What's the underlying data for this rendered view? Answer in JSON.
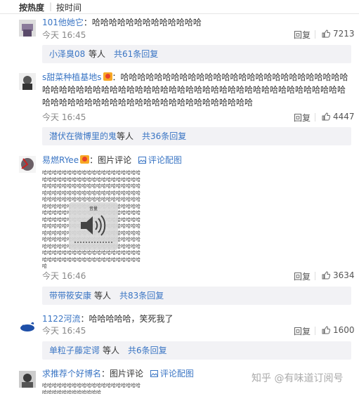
{
  "sort": {
    "hot": "按热度",
    "sep": "|",
    "time": "按时间"
  },
  "icons": {
    "like": "thumbs-up-icon",
    "image": "image-icon",
    "badge": "vip-badge-icon",
    "speaker": "speaker-icon"
  },
  "colors": {
    "link": "#3a75c4",
    "sub_bg": "#f2f2f5",
    "badge": "#f7a825"
  },
  "comments": [
    {
      "user": "101他她它",
      "text": "：哈哈哈哈哈哈哈哈哈哈哈哈哈",
      "time": "今天 16:45",
      "reply": "回复",
      "likes": "7213",
      "sub": {
        "who": "小泽臭08",
        "rest": " 等人 ",
        "count": "共61条回复"
      }
    },
    {
      "user": "s甜菜种植基地s",
      "text": "：哈哈哈哈哈哈哈哈哈哈哈哈哈哈哈哈哈哈哈哈哈哈哈哈哈哈哈哈哈哈哈哈哈哈哈哈哈哈哈哈哈哈哈哈哈哈哈哈哈哈哈哈哈哈哈哈哈哈哈哈哈哈哈哈哈哈哈哈哈哈哈哈哈哈哈哈哈哈哈哈哈哈哈哈哈哈哈哈",
      "time": "今天 16:45",
      "reply": "回复",
      "likes": "4447",
      "sub": {
        "who": "潜伏在微博里的鬼",
        "rest": " 等人 ",
        "count": "共36条回复"
      }
    },
    {
      "user": "易燃RYee",
      "text": "：图片评论",
      "piclink": "评论配图",
      "pic_text": "哈哈哈哈哈哈哈哈哈哈哈哈哈哈哈哈哈哈哈哈哈哈哈哈哈哈哈哈哈哈哈哈哈哈哈哈哈哈哈哈哈哈哈哈哈哈哈哈哈哈哈哈哈哈哈哈哈哈哈哈哈哈哈哈哈哈哈哈哈哈哈哈哈哈哈哈哈哈哈哈哈哈哈哈哈哈哈哈哈哈哈哈哈哈哈哈哈哈哈哈哈哈哈哈哈哈哈哈哈哈哈哈哈哈哈哈哈哈哈哈哈哈哈哈哈哈哈哈哈哈哈哈哈哈哈哈哈哈哈哈哈哈哈哈哈哈哈哈哈哈哈哈哈哈哈哈哈哈哈哈哈哈哈哈哈哈哈哈哈哈哈哈哈哈哈哈哈哈哈哈哈哈哈哈哈哈哈哈哈哈哈哈哈哈哈哈哈哈哈哈哈哈哈哈哈哈哈哈哈哈哈哈哈哈哈哈哈哈哈哈哈哈哈哈哈哈哈哈哈哈哈哈哈哈哈哈哈哈哈哈哈哈哈哈哈哈哈哈哈哈哈哈哈哈哈哈哈哈哈哈哈哈哈哈哈哈哈哈哈哈哈哈哈哈哈哈哈哈哈哈哈",
      "popup_label": "音量",
      "time": "今天 16:46",
      "reply": "回复",
      "likes": "3634",
      "sub": {
        "who": "带带筱安康",
        "rest": " 等人 ",
        "count": "共83条回复"
      }
    },
    {
      "user": "1122河流",
      "text": "：哈哈哈哈哈，笑死我了",
      "time": "今天 16:45",
      "reply": "回复",
      "likes": "1600",
      "sub": {
        "who": "单粒子藤定谔",
        "rest": " 等人 ",
        "count": "共6条回复"
      }
    },
    {
      "user": "求推荐个好博名",
      "text": "：图片评论",
      "piclink": "评论配图",
      "pic_text": "哈哈哈哈哈哈哈哈哈哈哈哈哈哈哈哈哈哈哈哈哈哈哈哈哈哈哈哈哈哈哈哈"
    }
  ],
  "watermark": "知乎 @有味道订阅号"
}
